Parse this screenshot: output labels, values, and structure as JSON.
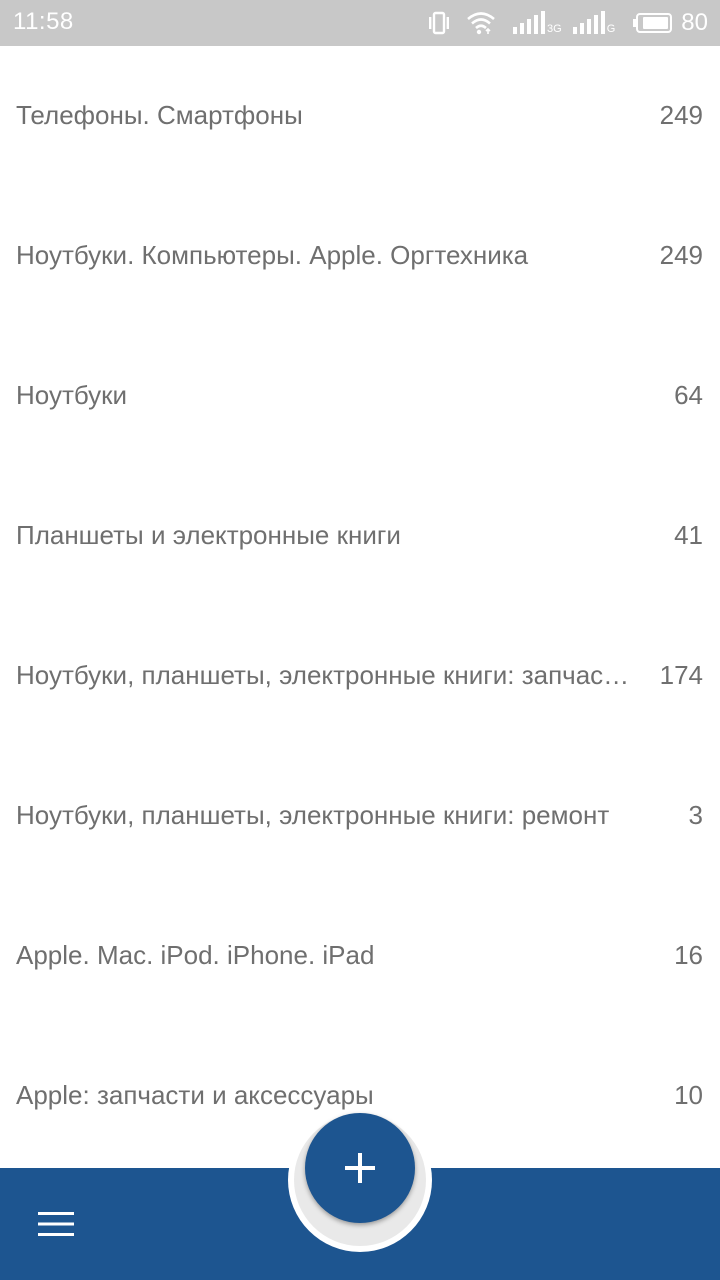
{
  "status_bar": {
    "time": "11:58",
    "network_label_1": "3G",
    "network_label_2": "G",
    "battery_level": "80",
    "icons": [
      "vibrate-icon",
      "wifi-icon",
      "signal-icon",
      "signal-icon",
      "battery-icon"
    ]
  },
  "categories": [
    {
      "name": "Телефоны. Смартфоны",
      "count": "249"
    },
    {
      "name": "Ноутбуки. Компьютеры. Apple. Оргтехника",
      "count": "249"
    },
    {
      "name": "Ноутбуки",
      "count": "64"
    },
    {
      "name": "Планшеты и электронные книги",
      "count": "41"
    },
    {
      "name": "Ноутбуки, планшеты, электронные книги: запчасти и аксессуары",
      "count": "174"
    },
    {
      "name": "Ноутбуки, планшеты, электронные книги: ремонт",
      "count": "3"
    },
    {
      "name": "Apple. Mac. iPod. iPhone. iPad",
      "count": "16"
    },
    {
      "name": "Apple: запчасти и аксессуары",
      "count": "10"
    }
  ],
  "bottom_bar": {
    "menu_icon": "hamburger-menu-icon",
    "fab_icon": "plus-icon"
  },
  "colors": {
    "status_bar": "#c8c8c8",
    "accent": "#1d5590",
    "text": "#6f6f6f",
    "background": "#ffffff"
  }
}
